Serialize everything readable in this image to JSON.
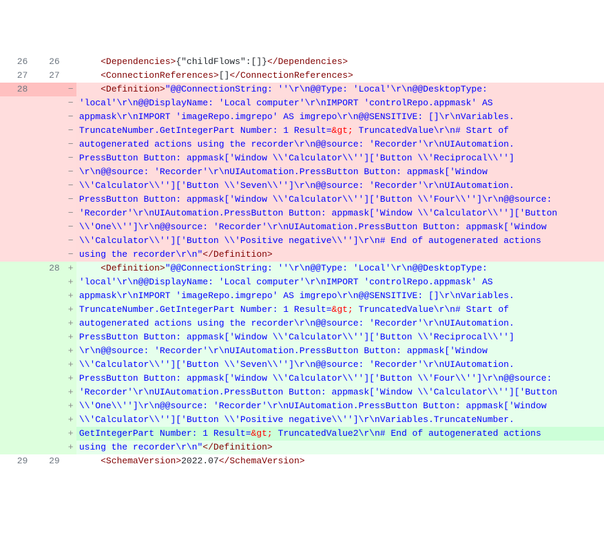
{
  "diff": {
    "rows": [
      {
        "type": "ctx",
        "old": "26",
        "new": "26",
        "mark": "",
        "segments": [
          {
            "t": "    "
          },
          {
            "t": "<",
            "c": "tag"
          },
          {
            "t": "Dependencies",
            "c": "tag"
          },
          {
            "t": ">",
            "c": "tag"
          },
          {
            "t": "{\"childFlows\":[]}"
          },
          {
            "t": "</",
            "c": "tag"
          },
          {
            "t": "Dependencies",
            "c": "tag"
          },
          {
            "t": ">",
            "c": "tag"
          }
        ]
      },
      {
        "type": "ctx",
        "old": "27",
        "new": "27",
        "mark": "",
        "segments": [
          {
            "t": "    "
          },
          {
            "t": "<",
            "c": "tag"
          },
          {
            "t": "ConnectionReferences",
            "c": "tag"
          },
          {
            "t": ">",
            "c": "tag"
          },
          {
            "t": "[]"
          },
          {
            "t": "</",
            "c": "tag"
          },
          {
            "t": "ConnectionReferences",
            "c": "tag"
          },
          {
            "t": ">",
            "c": "tag"
          }
        ]
      },
      {
        "type": "del",
        "hl": true,
        "old": "28",
        "new": "",
        "mark": "−",
        "segments": [
          {
            "t": "    "
          },
          {
            "t": "<",
            "c": "tag"
          },
          {
            "t": "Definition",
            "c": "tag"
          },
          {
            "t": ">",
            "c": "tag"
          },
          {
            "t": "\"@@ConnectionString: ''\\r\\n@@Type: 'Local'\\r\\n@@DesktopType: ",
            "c": "str"
          }
        ]
      },
      {
        "type": "del",
        "old": "",
        "new": "",
        "mark": "−",
        "segments": [
          {
            "t": "'local'\\r\\n@@DisplayName: 'Local computer'\\r\\nIMPORT 'controlRepo.appmask' AS ",
            "c": "str"
          }
        ]
      },
      {
        "type": "del",
        "old": "",
        "new": "",
        "mark": "−",
        "segments": [
          {
            "t": "appmask\\r\\nIMPORT 'imageRepo.imgrepo' AS imgrepo\\r\\n@@SENSITIVE: []\\r\\nVariables.",
            "c": "str"
          }
        ]
      },
      {
        "type": "del",
        "old": "",
        "new": "",
        "mark": "−",
        "segments": [
          {
            "t": "TruncateNumber.GetIntegerPart Number: 1 Result=",
            "c": "str"
          },
          {
            "t": "&gt;",
            "c": "amp"
          },
          {
            "t": " TruncatedValue\\r\\n# Start of ",
            "c": "str"
          }
        ]
      },
      {
        "type": "del",
        "old": "",
        "new": "",
        "mark": "−",
        "segments": [
          {
            "t": "autogenerated actions using the recorder\\r\\n@@source: 'Recorder'\\r\\nUIAutomation.",
            "c": "str"
          }
        ]
      },
      {
        "type": "del",
        "old": "",
        "new": "",
        "mark": "−",
        "segments": [
          {
            "t": "PressButton Button: appmask['Window \\\\'Calculator\\\\'']['Button \\\\'Reciprocal\\\\'']",
            "c": "str"
          }
        ]
      },
      {
        "type": "del",
        "old": "",
        "new": "",
        "mark": "−",
        "segments": [
          {
            "t": "\\r\\n@@source: 'Recorder'\\r\\nUIAutomation.PressButton Button: appmask['Window ",
            "c": "str"
          }
        ]
      },
      {
        "type": "del",
        "old": "",
        "new": "",
        "mark": "−",
        "segments": [
          {
            "t": "\\\\'Calculator\\\\'']['Button \\\\'Seven\\\\'']\\r\\n@@source: 'Recorder'\\r\\nUIAutomation.",
            "c": "str"
          }
        ]
      },
      {
        "type": "del",
        "old": "",
        "new": "",
        "mark": "−",
        "segments": [
          {
            "t": "PressButton Button: appmask['Window \\\\'Calculator\\\\'']['Button \\\\'Four\\\\'']\\r\\n@@source: ",
            "c": "str"
          }
        ]
      },
      {
        "type": "del",
        "old": "",
        "new": "",
        "mark": "−",
        "segments": [
          {
            "t": "'Recorder'\\r\\nUIAutomation.PressButton Button: appmask['Window \\\\'Calculator\\\\'']['Button ",
            "c": "str"
          }
        ]
      },
      {
        "type": "del",
        "old": "",
        "new": "",
        "mark": "−",
        "segments": [
          {
            "t": "\\\\'One\\\\'']\\r\\n@@source: 'Recorder'\\r\\nUIAutomation.PressButton Button: appmask['Window ",
            "c": "str"
          }
        ]
      },
      {
        "type": "del",
        "old": "",
        "new": "",
        "mark": "−",
        "segments": [
          {
            "t": "\\\\'Calculator\\\\'']['Button \\\\'Positive negative\\\\'']\\r\\n# End of autogenerated actions ",
            "c": "str"
          }
        ]
      },
      {
        "type": "del",
        "old": "",
        "new": "",
        "mark": "−",
        "segments": [
          {
            "t": "using the recorder\\r\\n\"",
            "c": "str"
          },
          {
            "t": "</",
            "c": "tag"
          },
          {
            "t": "Definition",
            "c": "tag"
          },
          {
            "t": ">",
            "c": "tag"
          }
        ]
      },
      {
        "type": "add",
        "old": "",
        "new": "28",
        "mark": "+",
        "segments": [
          {
            "t": "    "
          },
          {
            "t": "<",
            "c": "tag"
          },
          {
            "t": "Definition",
            "c": "tag"
          },
          {
            "t": ">",
            "c": "tag"
          },
          {
            "t": "\"@@ConnectionString: ''\\r\\n@@Type: 'Local'\\r\\n@@DesktopType: ",
            "c": "str"
          }
        ]
      },
      {
        "type": "add",
        "old": "",
        "new": "",
        "mark": "+",
        "segments": [
          {
            "t": "'local'\\r\\n@@DisplayName: 'Local computer'\\r\\nIMPORT 'controlRepo.appmask' AS ",
            "c": "str"
          }
        ]
      },
      {
        "type": "add",
        "old": "",
        "new": "",
        "mark": "+",
        "segments": [
          {
            "t": "appmask\\r\\nIMPORT 'imageRepo.imgrepo' AS imgrepo\\r\\n@@SENSITIVE: []\\r\\nVariables.",
            "c": "str"
          }
        ]
      },
      {
        "type": "add",
        "old": "",
        "new": "",
        "mark": "+",
        "segments": [
          {
            "t": "TruncateNumber.GetIntegerPart Number: 1 Result=",
            "c": "str"
          },
          {
            "t": "&gt;",
            "c": "amp"
          },
          {
            "t": " TruncatedValue\\r\\n# Start of ",
            "c": "str"
          }
        ]
      },
      {
        "type": "add",
        "old": "",
        "new": "",
        "mark": "+",
        "segments": [
          {
            "t": "autogenerated actions using the recorder\\r\\n@@source: 'Recorder'\\r\\nUIAutomation.",
            "c": "str"
          }
        ]
      },
      {
        "type": "add",
        "old": "",
        "new": "",
        "mark": "+",
        "segments": [
          {
            "t": "PressButton Button: appmask['Window \\\\'Calculator\\\\'']['Button \\\\'Reciprocal\\\\'']",
            "c": "str"
          }
        ]
      },
      {
        "type": "add",
        "old": "",
        "new": "",
        "mark": "+",
        "segments": [
          {
            "t": "\\r\\n@@source: 'Recorder'\\r\\nUIAutomation.PressButton Button: appmask['Window ",
            "c": "str"
          }
        ]
      },
      {
        "type": "add",
        "old": "",
        "new": "",
        "mark": "+",
        "segments": [
          {
            "t": "\\\\'Calculator\\\\'']['Button \\\\'Seven\\\\'']\\r\\n@@source: 'Recorder'\\r\\nUIAutomation.",
            "c": "str"
          }
        ]
      },
      {
        "type": "add",
        "old": "",
        "new": "",
        "mark": "+",
        "segments": [
          {
            "t": "PressButton Button: appmask['Window \\\\'Calculator\\\\'']['Button \\\\'Four\\\\'']\\r\\n@@source: ",
            "c": "str"
          }
        ]
      },
      {
        "type": "add",
        "old": "",
        "new": "",
        "mark": "+",
        "segments": [
          {
            "t": "'Recorder'\\r\\nUIAutomation.PressButton Button: appmask['Window \\\\'Calculator\\\\'']['Button ",
            "c": "str"
          }
        ]
      },
      {
        "type": "add",
        "old": "",
        "new": "",
        "mark": "+",
        "segments": [
          {
            "t": "\\\\'One\\\\'']\\r\\n@@source: 'Recorder'\\r\\nUIAutomation.PressButton Button: appmask['Window ",
            "c": "str"
          }
        ]
      },
      {
        "type": "add",
        "old": "",
        "new": "",
        "mark": "+",
        "segments": [
          {
            "t": "\\\\'Calculator\\\\'']['Button \\\\'Positive negative\\\\'']\\r\\n",
            "c": "str"
          },
          {
            "t": "Variables.TruncateNumber.",
            "c": "str"
          }
        ]
      },
      {
        "type": "add",
        "hl": true,
        "old": "",
        "new": "",
        "mark": "+",
        "segments": [
          {
            "t": "GetIntegerPart Number: 1 Result=",
            "c": "str"
          },
          {
            "t": "&gt;",
            "c": "amp"
          },
          {
            "t": " TruncatedValue2\\r\\n",
            "c": "str"
          },
          {
            "t": "# End of autogenerated actions ",
            "c": "str"
          }
        ]
      },
      {
        "type": "add",
        "old": "",
        "new": "",
        "mark": "+",
        "segments": [
          {
            "t": "using the recorder\\r\\n\"",
            "c": "str"
          },
          {
            "t": "</",
            "c": "tag"
          },
          {
            "t": "Definition",
            "c": "tag"
          },
          {
            "t": ">",
            "c": "tag"
          }
        ]
      },
      {
        "type": "ctx",
        "old": "29",
        "new": "29",
        "mark": "",
        "segments": [
          {
            "t": "    "
          },
          {
            "t": "<",
            "c": "tag"
          },
          {
            "t": "SchemaVersion",
            "c": "tag"
          },
          {
            "t": ">",
            "c": "tag"
          },
          {
            "t": "2022.07"
          },
          {
            "t": "</",
            "c": "tag"
          },
          {
            "t": "SchemaVersion",
            "c": "tag"
          },
          {
            "t": ">",
            "c": "tag"
          }
        ]
      }
    ]
  }
}
